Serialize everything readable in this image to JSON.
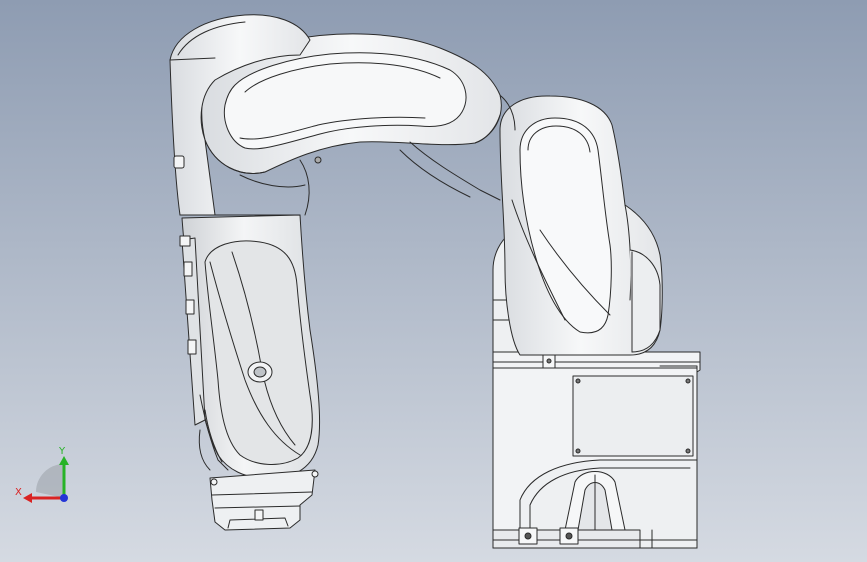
{
  "viewport": {
    "background_top": "#8e9cb2",
    "background_bottom": "#d5dae2",
    "part_fill": "#f3f4f6",
    "part_shade": "#d9dce0",
    "edge_color": "#2b2b2b"
  },
  "triad": {
    "x_label": "X",
    "y_label": "Y",
    "x_color": "#d92323",
    "y_color": "#27b327",
    "z_color": "#2435d6"
  }
}
